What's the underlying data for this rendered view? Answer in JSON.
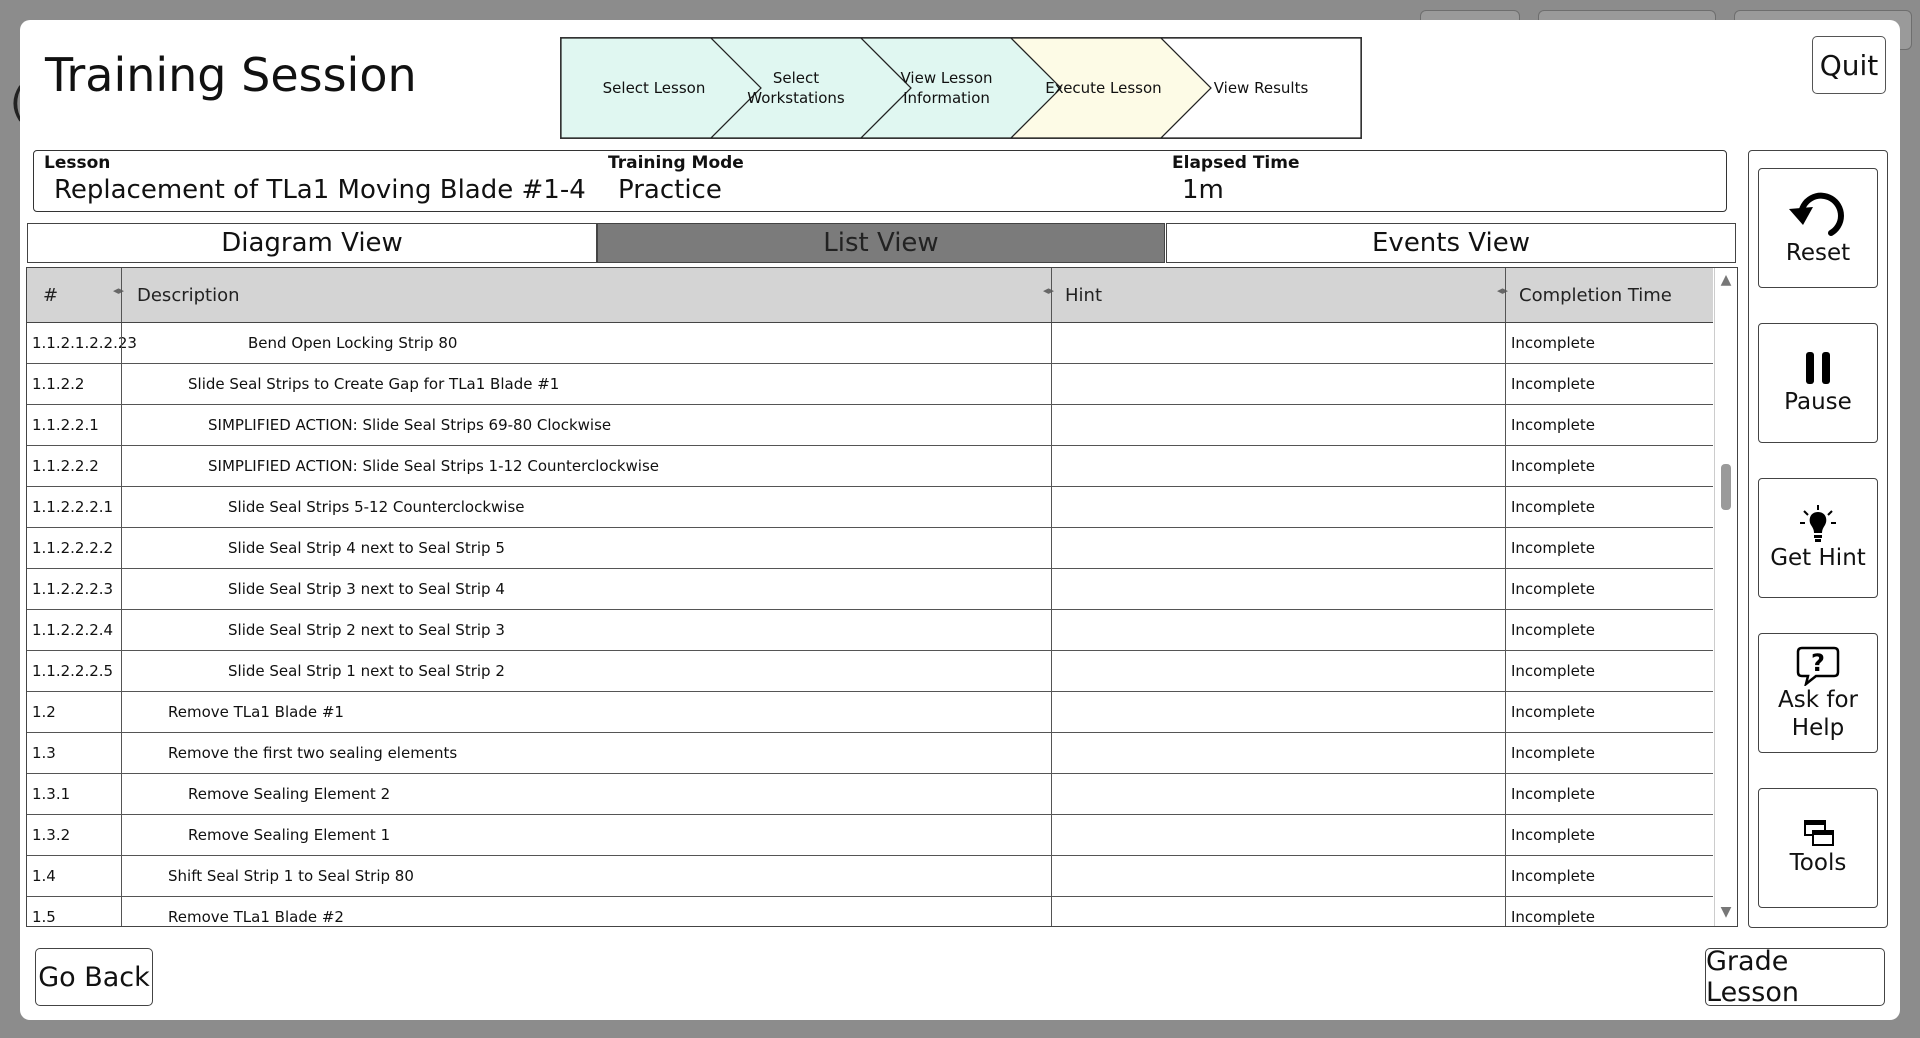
{
  "title": "Training Session",
  "quit_label": "Quit",
  "wizard_steps": [
    {
      "label": "Select Lesson",
      "state": "complete"
    },
    {
      "label": "Select Workstations",
      "state": "complete"
    },
    {
      "label": "View Lesson Information",
      "state": "complete"
    },
    {
      "label": "Execute Lesson",
      "state": "current"
    },
    {
      "label": "View Results",
      "state": "pending"
    }
  ],
  "wizard_colors": {
    "complete": "#e0f7f1",
    "current": "#fdfbe6",
    "pending": "#ffffff"
  },
  "info": {
    "lesson_label": "Lesson",
    "lesson_value": "Replacement of TLa1 Moving Blade #1-4",
    "mode_label": "Training Mode",
    "mode_value": "Practice",
    "elapsed_label": "Elapsed Time",
    "elapsed_value": "1m"
  },
  "tabs": [
    {
      "label": "Diagram View",
      "active": false
    },
    {
      "label": "List View",
      "active": true
    },
    {
      "label": "Events View",
      "active": false
    }
  ],
  "table": {
    "columns": [
      "#",
      "Description",
      "Hint",
      "Completion Time"
    ],
    "rows": [
      {
        "num": "1.1.2.1.2.2.23",
        "desc": "Bend Open Locking Strip 80",
        "indent": 5,
        "hint": "",
        "time": "Incomplete"
      },
      {
        "num": "1.1.2.2",
        "desc": "Slide Seal Strips to Create Gap for TLa1 Blade #1",
        "indent": 2,
        "hint": "",
        "time": "Incomplete"
      },
      {
        "num": "1.1.2.2.1",
        "desc": "SIMPLIFIED ACTION: Slide Seal Strips 69-80 Clockwise",
        "indent": 3,
        "hint": "",
        "time": "Incomplete"
      },
      {
        "num": "1.1.2.2.2",
        "desc": "SIMPLIFIED ACTION: Slide Seal Strips 1-12 Counterclockwise",
        "indent": 3,
        "hint": "",
        "time": "Incomplete"
      },
      {
        "num": "1.1.2.2.2.1",
        "desc": "Slide Seal Strips 5-12 Counterclockwise",
        "indent": 4,
        "hint": "",
        "time": "Incomplete"
      },
      {
        "num": "1.1.2.2.2.2",
        "desc": "Slide Seal Strip 4 next to Seal Strip 5",
        "indent": 4,
        "hint": "",
        "time": "Incomplete"
      },
      {
        "num": "1.1.2.2.2.3",
        "desc": "Slide Seal Strip 3 next to Seal Strip 4",
        "indent": 4,
        "hint": "",
        "time": "Incomplete"
      },
      {
        "num": "1.1.2.2.2.4",
        "desc": "Slide Seal Strip 2 next to Seal Strip 3",
        "indent": 4,
        "hint": "",
        "time": "Incomplete"
      },
      {
        "num": "1.1.2.2.2.5",
        "desc": "Slide Seal Strip 1 next to Seal Strip 2",
        "indent": 4,
        "hint": "",
        "time": "Incomplete"
      },
      {
        "num": "1.2",
        "desc": "Remove TLa1 Blade #1",
        "indent": 1,
        "hint": "",
        "time": "Incomplete"
      },
      {
        "num": "1.3",
        "desc": "Remove the first two sealing elements",
        "indent": 1,
        "hint": "",
        "time": "Incomplete"
      },
      {
        "num": "1.3.1",
        "desc": "Remove Sealing Element 2",
        "indent": 2,
        "hint": "",
        "time": "Incomplete"
      },
      {
        "num": "1.3.2",
        "desc": "Remove Sealing Element 1",
        "indent": 2,
        "hint": "",
        "time": "Incomplete"
      },
      {
        "num": "1.4",
        "desc": "Shift Seal Strip 1 to Seal Strip 80",
        "indent": 1,
        "hint": "",
        "time": "Incomplete"
      },
      {
        "num": "1.5",
        "desc": "Remove TLa1 Blade #2",
        "indent": 1,
        "hint": "",
        "time": "Incomplete"
      }
    ]
  },
  "side_buttons": [
    {
      "label": "Reset",
      "icon": "reset-icon"
    },
    {
      "label": "Pause",
      "icon": "pause-icon"
    },
    {
      "label": "Get Hint",
      "icon": "lightbulb-icon"
    },
    {
      "label": "Ask for Help",
      "icon": "question-bubble-icon"
    },
    {
      "label": "Tools",
      "icon": "tools-icon"
    }
  ],
  "go_back_label": "Go Back",
  "grade_label": "Grade Lesson"
}
